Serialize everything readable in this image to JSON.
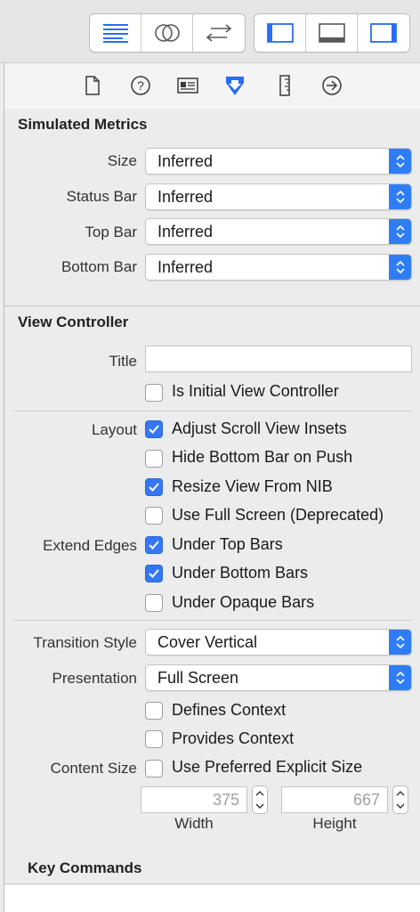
{
  "simulated_metrics": {
    "title": "Simulated Metrics",
    "rows": [
      {
        "label": "Size",
        "value": "Inferred"
      },
      {
        "label": "Status Bar",
        "value": "Inferred"
      },
      {
        "label": "Top Bar",
        "value": "Inferred"
      },
      {
        "label": "Bottom Bar",
        "value": "Inferred"
      }
    ]
  },
  "view_controller": {
    "title": "View Controller",
    "title_label": "Title",
    "title_value": "",
    "is_initial": {
      "label": "Is Initial View Controller",
      "checked": false
    },
    "layout_label": "Layout",
    "layout_options": [
      {
        "label": "Adjust Scroll View Insets",
        "checked": true
      },
      {
        "label": "Hide Bottom Bar on Push",
        "checked": false
      },
      {
        "label": "Resize View From NIB",
        "checked": true
      },
      {
        "label": "Use Full Screen (Deprecated)",
        "checked": false
      }
    ],
    "extend_edges_label": "Extend Edges",
    "extend_edges": [
      {
        "label": "Under Top Bars",
        "checked": true
      },
      {
        "label": "Under Bottom Bars",
        "checked": true
      },
      {
        "label": "Under Opaque Bars",
        "checked": false
      }
    ],
    "transition_style": {
      "label": "Transition Style",
      "value": "Cover Vertical"
    },
    "presentation": {
      "label": "Presentation",
      "value": "Full Screen"
    },
    "defines_context": {
      "label": "Defines Context",
      "checked": false
    },
    "provides_context": {
      "label": "Provides Context",
      "checked": false
    },
    "content_size": {
      "label": "Content Size",
      "option": {
        "label": "Use Preferred Explicit Size",
        "checked": false
      },
      "width": "375",
      "height": "667",
      "width_caption": "Width",
      "height_caption": "Height"
    }
  },
  "key_commands": {
    "title": "Key Commands"
  },
  "colors": {
    "accent": "#3478f6",
    "icon_blue": "#2a6df4",
    "icon_gray": "#5a5a5a"
  }
}
